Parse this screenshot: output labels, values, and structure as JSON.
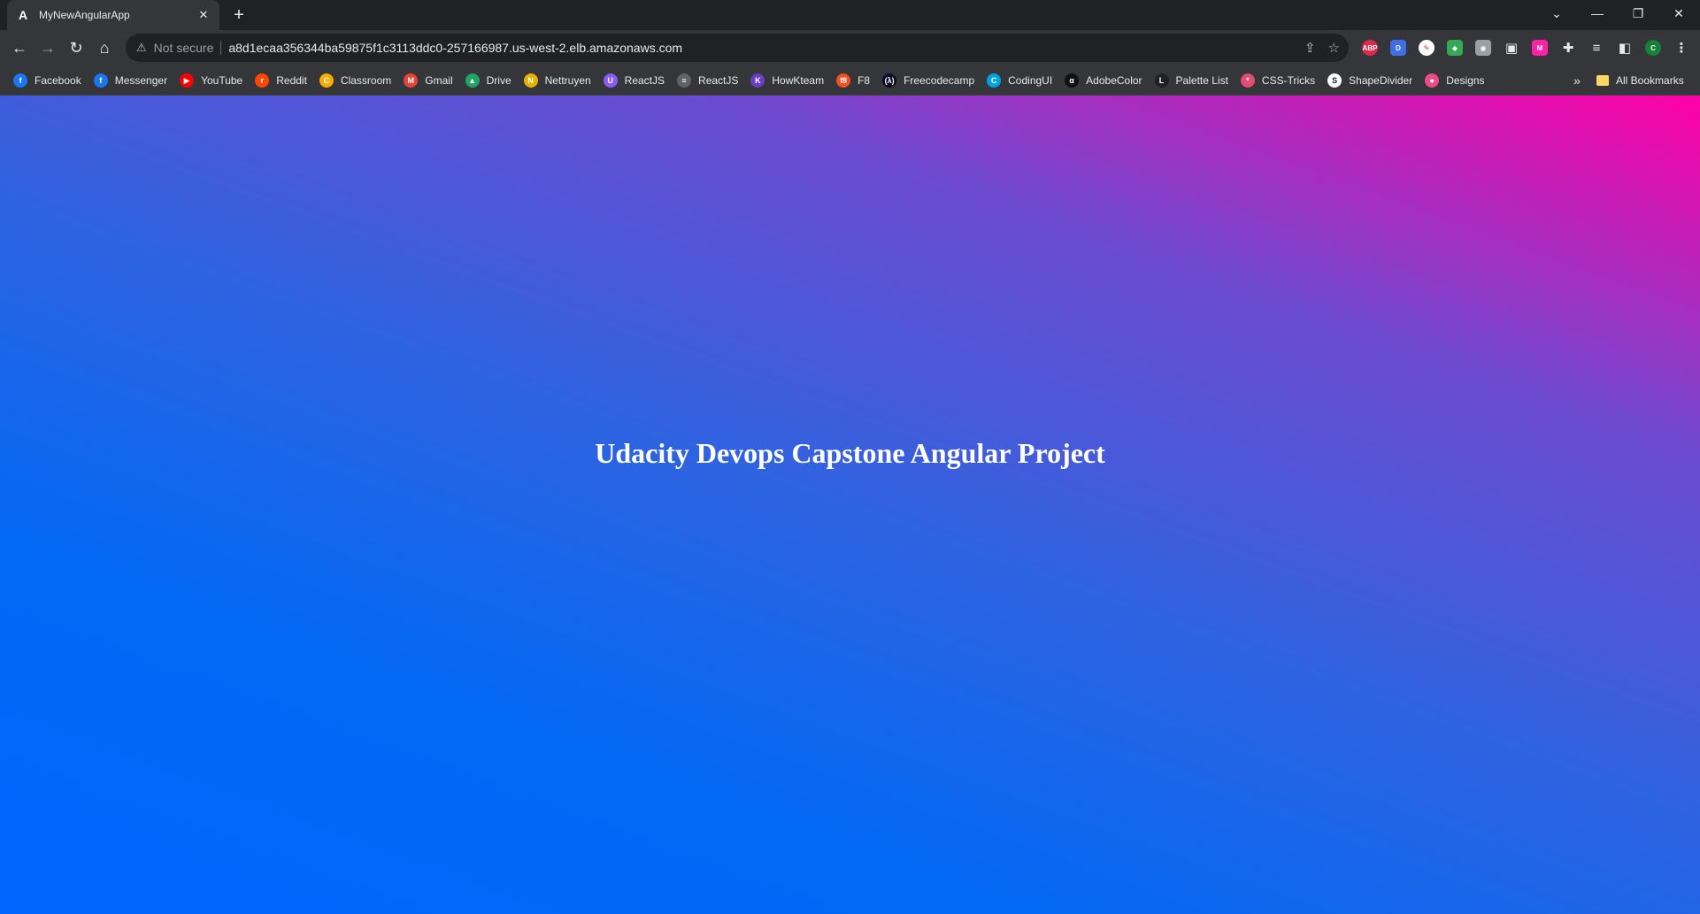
{
  "tab": {
    "favicon": "A",
    "title": "MyNewAngularApp",
    "close": "✕"
  },
  "newtab": "+",
  "window": {
    "min": "—",
    "restore": "❐",
    "close": "✕",
    "tablist": "⌄"
  },
  "toolbar": {
    "back": "←",
    "forward": "→",
    "reload": "↻",
    "home": "⌂"
  },
  "address": {
    "warning_icon": "⚠",
    "security_label": "Not secure",
    "url": "a8d1ecaa356344ba59875f1c3113ddc0-257166987.us-west-2.elb.amazonaws.com",
    "share_icon": "⇪",
    "star_icon": "☆"
  },
  "extensions": [
    {
      "name": "adblock-icon",
      "text": "ABP",
      "color": "#e0284a",
      "round": true
    },
    {
      "name": "d-extension-icon",
      "text": "D",
      "color": "#3e6fe8",
      "round": false
    },
    {
      "name": "circle-pen-icon",
      "text": "✎",
      "color": "#ffffff",
      "round": true
    },
    {
      "name": "color-pick-icon",
      "text": "◆",
      "color": "#34a853",
      "round": false
    },
    {
      "name": "camera-icon",
      "text": "◉",
      "color": "#9aa0a6",
      "round": false
    },
    {
      "name": "screen-icon",
      "text": "▣",
      "color": "#35363a",
      "round": false
    },
    {
      "name": "m-extension-icon",
      "text": "M",
      "color": "#ff1fa8",
      "round": false
    },
    {
      "name": "puzzle-icon",
      "text": "✚",
      "color": "#35363a",
      "round": false
    },
    {
      "name": "reading-list-icon",
      "text": "≡",
      "color": "#35363a",
      "round": false
    },
    {
      "name": "side-panel-icon",
      "text": "◧",
      "color": "#35363a",
      "round": false
    },
    {
      "name": "profile-avatar",
      "text": "C",
      "color": "#188038",
      "round": true
    },
    {
      "name": "menu-icon",
      "text": "⋮",
      "color": "#35363a",
      "round": false
    }
  ],
  "bookmarks": [
    {
      "label": "Facebook",
      "icon": "f",
      "color": "#1877f2"
    },
    {
      "label": "Messenger",
      "icon": "f",
      "color": "#1877f2"
    },
    {
      "label": "YouTube",
      "icon": "▶",
      "color": "#ff0000"
    },
    {
      "label": "Reddit",
      "icon": "r",
      "color": "#ff4500"
    },
    {
      "label": "Classroom",
      "icon": "C",
      "color": "#f9ab00"
    },
    {
      "label": "Gmail",
      "icon": "M",
      "color": "#ea4335"
    },
    {
      "label": "Drive",
      "icon": "▲",
      "color": "#1fa463"
    },
    {
      "label": "Nettruyen",
      "icon": "N",
      "color": "#e8b100"
    },
    {
      "label": "ReactJS",
      "icon": "U",
      "color": "#8b5cf6"
    },
    {
      "label": "ReactJS",
      "icon": "≡",
      "color": "#5f6368"
    },
    {
      "label": "HowKteam",
      "icon": "K",
      "color": "#6a3ec2"
    },
    {
      "label": "F8",
      "icon": "f8",
      "color": "#f05123"
    },
    {
      "label": "Freecodecamp",
      "icon": "(λ)",
      "color": "#0a0a23"
    },
    {
      "label": "CodingUI",
      "icon": "C",
      "color": "#00a3e0"
    },
    {
      "label": "AdobeColor",
      "icon": "α",
      "color": "#111111"
    },
    {
      "label": "Palette List",
      "icon": "L",
      "color": "#202124"
    },
    {
      "label": "CSS-Tricks",
      "icon": "*",
      "color": "#e34c70"
    },
    {
      "label": "ShapeDivider",
      "icon": "S",
      "color": "#ffffff"
    },
    {
      "label": "Designs",
      "icon": "●",
      "color": "#ea4c89"
    }
  ],
  "bookmarks_more": "»",
  "all_bookmarks": "All Bookmarks",
  "page": {
    "heading": "Udacity Devops Capstone Angular Project"
  }
}
